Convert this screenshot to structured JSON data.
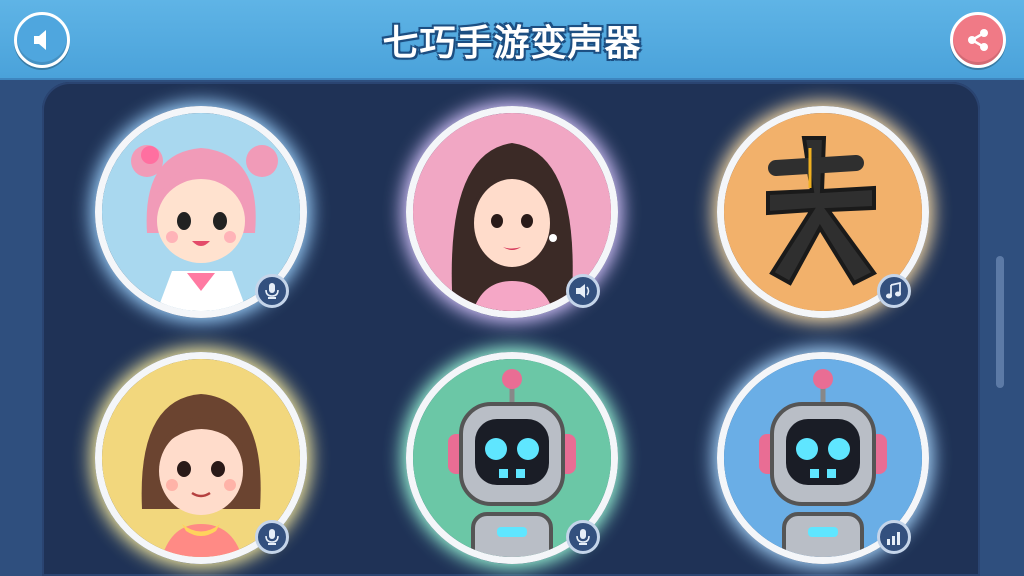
{
  "header": {
    "title": "七巧手游变声器",
    "left_icon": "speaker-icon",
    "right_icon": "share-icon"
  },
  "colors": {
    "header": "#4aa2da",
    "panel": "#1f3256",
    "background": "#2f4f7e",
    "share_button": "#f07a86"
  },
  "voices": [
    {
      "avatar": "pink-hair-girl",
      "bg": "#a9d8ef",
      "glow": "#9fd4ff",
      "badge_icon": "microphone-icon"
    },
    {
      "avatar": "long-hair-woman",
      "bg": "#f1a7c4",
      "glow": "#d9c6ff",
      "badge_icon": "speaker-voice-icon"
    },
    {
      "avatar": "black-glyph",
      "bg": "#f2b16b",
      "glow": "#ffe0a8",
      "badge_icon": "music-note-icon"
    },
    {
      "avatar": "short-hair-girl",
      "bg": "#f2d77d",
      "glow": "#fff1a0",
      "badge_icon": "microphone-icon"
    },
    {
      "avatar": "robot",
      "bg": "#6bc7a6",
      "glow": "#9fffdc",
      "badge_icon": "microphone-icon"
    },
    {
      "avatar": "robot",
      "bg": "#6aaee6",
      "glow": "#a9d8ff",
      "badge_icon": "signal-bars-icon"
    }
  ]
}
